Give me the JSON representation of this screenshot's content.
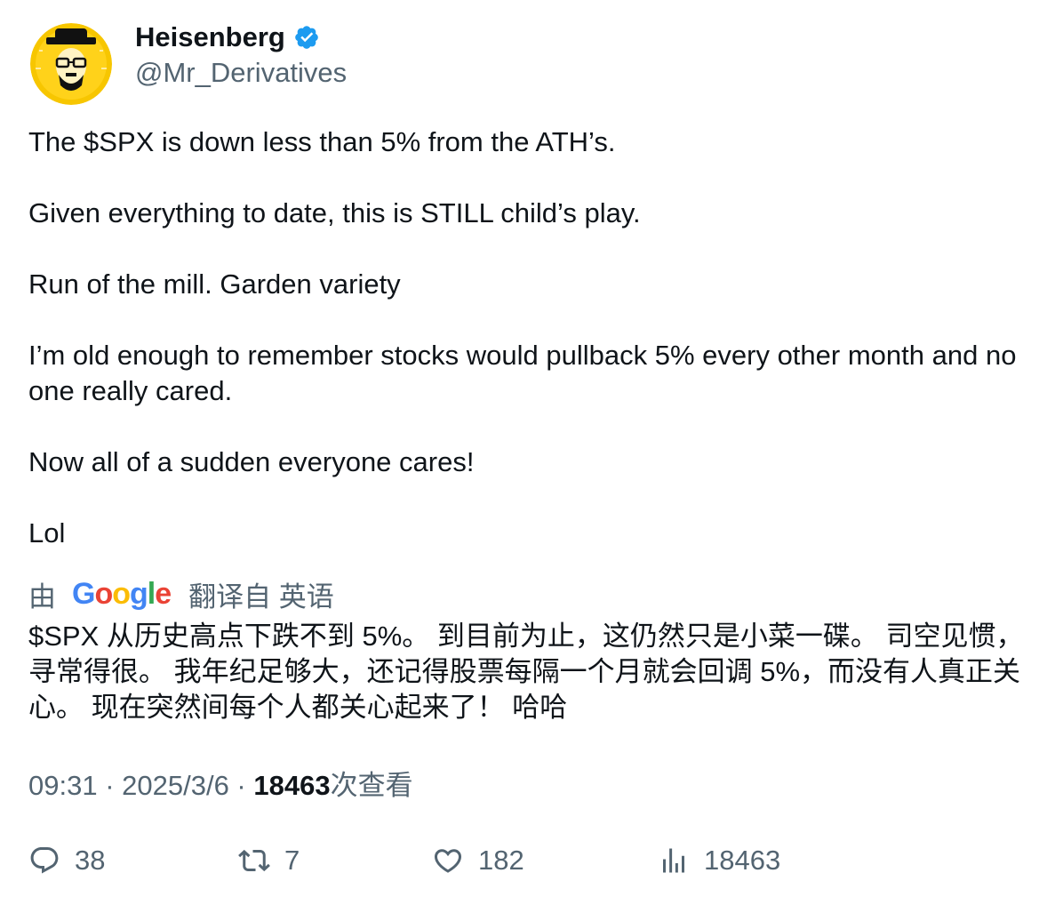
{
  "author": {
    "display_name": "Heisenberg",
    "handle": "@Mr_Derivatives",
    "avatar_icon": "heisenberg-avatar",
    "verified_color": "#1d9bf0"
  },
  "tweet": {
    "paragraphs": [
      "The $SPX is down less than 5% from the ATH’s.",
      "Given everything to date, this is STILL child’s play.",
      "Run of the mill. Garden variety",
      "I’m old enough to remember stocks would pullback 5% every other month and no one really cared.",
      "Now all of a sudden everyone cares!",
      "Lol"
    ]
  },
  "translation": {
    "prefix": "由",
    "provider": "Google",
    "suffix": "翻译自 英语",
    "text": "$SPX 从历史高点下跌不到 5%。 到目前为止，这仍然只是小菜一碟。 司空见惯，寻常得很。 我年纪足够大，还记得股票每隔一个月就会回调 5%，而没有人真正关心。 现在突然间每个人都关心起来了！ 哈哈"
  },
  "meta": {
    "time": "09:31",
    "separator": " · ",
    "date": "2025/3/6",
    "views_count": "18463",
    "views_label": "次查看"
  },
  "actions": {
    "replies": "38",
    "retweets": "7",
    "likes": "182",
    "views": "18463"
  },
  "colors": {
    "text": "#0f1419",
    "secondary": "#536471",
    "accent": "#1d9bf0"
  }
}
